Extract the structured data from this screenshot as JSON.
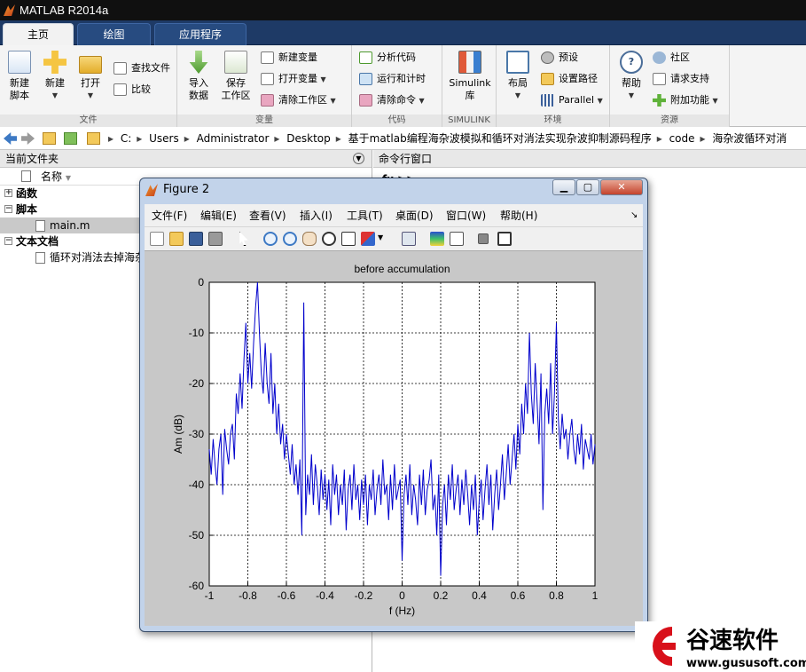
{
  "window": {
    "title": "MATLAB R2014a"
  },
  "tabs": [
    {
      "label": "主页"
    },
    {
      "label": "绘图"
    },
    {
      "label": "应用程序"
    }
  ],
  "ribbon": {
    "file": {
      "name": "文件",
      "new_script_1": "新建",
      "new_script_2": "脚本",
      "new": "新建",
      "open": "打开",
      "find_files": "查找文件",
      "compare": "比较"
    },
    "variable": {
      "name": "变量",
      "import_1": "导入",
      "import_2": "数据",
      "save_1": "保存",
      "save_2": "工作区",
      "new_var": "新建变量",
      "open_var": "打开变量",
      "clear_ws": "清除工作区"
    },
    "code": {
      "name": "代码",
      "analyze": "分析代码",
      "run_time": "运行和计时",
      "clear_cmd": "清除命令"
    },
    "simulink": {
      "name": "SIMULINK",
      "lib_1": "Simulink",
      "lib_2": "库"
    },
    "env": {
      "name": "环境",
      "layout": "布局",
      "prefs": "预设",
      "set_path": "设置路径",
      "parallel": "Parallel"
    },
    "resources": {
      "name": "资源",
      "help": "帮助",
      "community": "社区",
      "support": "请求支持",
      "addons": "附加功能"
    }
  },
  "address": {
    "crumbs": [
      "C:",
      "Users",
      "Administrator",
      "Desktop",
      "基于matlab编程海杂波模拟和循环对消法实现杂波抑制源码程序",
      "code",
      "海杂波循环对消"
    ]
  },
  "current_folder": {
    "title": "当前文件夹",
    "col_name": "名称",
    "items": [
      {
        "label": "函数"
      },
      {
        "label": "脚本"
      },
      {
        "label": "main.m"
      },
      {
        "label": "文本文档"
      },
      {
        "label": "循环对消法去掉海杂"
      }
    ]
  },
  "command_window": {
    "title": "命令行窗口",
    "prompt": "fx >>"
  },
  "figure": {
    "title": "Figure 2",
    "menu": [
      "文件(F)",
      "编辑(E)",
      "查看(V)",
      "插入(I)",
      "工具(T)",
      "桌面(D)",
      "窗口(W)",
      "帮助(H)"
    ]
  },
  "chart_data": {
    "type": "line",
    "title": "before accumulation",
    "xlabel": "f (Hz)",
    "ylabel": "Am (dB)",
    "xlim": [
      -1,
      1
    ],
    "ylim": [
      -60,
      0
    ],
    "xticks": [
      -1,
      -0.8,
      -0.6,
      -0.4,
      -0.2,
      0,
      0.2,
      0.4,
      0.6,
      0.8,
      1
    ],
    "yticks": [
      0,
      -10,
      -20,
      -30,
      -40,
      -50,
      -60
    ],
    "grid": true,
    "series": [
      {
        "color": "#0000cc",
        "x": [
          -1,
          -0.99,
          -0.98,
          -0.97,
          -0.96,
          -0.95,
          -0.94,
          -0.93,
          -0.92,
          -0.91,
          -0.9,
          -0.89,
          -0.88,
          -0.87,
          -0.86,
          -0.85,
          -0.84,
          -0.83,
          -0.82,
          -0.81,
          -0.8,
          -0.79,
          -0.78,
          -0.77,
          -0.76,
          -0.75,
          -0.74,
          -0.73,
          -0.72,
          -0.71,
          -0.7,
          -0.69,
          -0.68,
          -0.67,
          -0.66,
          -0.65,
          -0.64,
          -0.63,
          -0.62,
          -0.61,
          -0.6,
          -0.59,
          -0.58,
          -0.57,
          -0.56,
          -0.55,
          -0.54,
          -0.53,
          -0.52,
          -0.51,
          -0.5,
          -0.49,
          -0.48,
          -0.47,
          -0.46,
          -0.45,
          -0.44,
          -0.43,
          -0.42,
          -0.41,
          -0.4,
          -0.39,
          -0.38,
          -0.37,
          -0.36,
          -0.35,
          -0.34,
          -0.33,
          -0.32,
          -0.31,
          -0.3,
          -0.29,
          -0.28,
          -0.27,
          -0.26,
          -0.25,
          -0.24,
          -0.23,
          -0.22,
          -0.21,
          -0.2,
          -0.19,
          -0.18,
          -0.17,
          -0.16,
          -0.15,
          -0.14,
          -0.13,
          -0.12,
          -0.11,
          -0.1,
          -0.09,
          -0.08,
          -0.07,
          -0.06,
          -0.05,
          -0.04,
          -0.03,
          -0.02,
          -0.01,
          0,
          0.01,
          0.02,
          0.03,
          0.04,
          0.05,
          0.06,
          0.07,
          0.08,
          0.09,
          0.1,
          0.11,
          0.12,
          0.13,
          0.14,
          0.15,
          0.16,
          0.17,
          0.18,
          0.19,
          0.2,
          0.21,
          0.22,
          0.23,
          0.24,
          0.25,
          0.26,
          0.27,
          0.28,
          0.29,
          0.3,
          0.31,
          0.32,
          0.33,
          0.34,
          0.35,
          0.36,
          0.37,
          0.38,
          0.39,
          0.4,
          0.41,
          0.42,
          0.43,
          0.44,
          0.45,
          0.46,
          0.47,
          0.48,
          0.49,
          0.5,
          0.51,
          0.52,
          0.53,
          0.54,
          0.55,
          0.56,
          0.57,
          0.58,
          0.59,
          0.6,
          0.61,
          0.62,
          0.63,
          0.64,
          0.65,
          0.66,
          0.67,
          0.68,
          0.69,
          0.7,
          0.71,
          0.72,
          0.73,
          0.74,
          0.75,
          0.76,
          0.77,
          0.78,
          0.79,
          0.8,
          0.81,
          0.82,
          0.83,
          0.84,
          0.85,
          0.86,
          0.87,
          0.88,
          0.89,
          0.9,
          0.91,
          0.92,
          0.93,
          0.94,
          0.95,
          0.96,
          0.97,
          0.98,
          0.99,
          1
        ],
        "y": [
          -33,
          -38,
          -31,
          -36,
          -40,
          -33,
          -30,
          -42,
          -29,
          -33,
          -36,
          -30,
          -28,
          -35,
          -22,
          -26,
          -18,
          -25,
          -15,
          -8,
          -20,
          -14,
          -21,
          -12,
          -5,
          0,
          -10,
          -18,
          -22,
          -12,
          -20,
          -24,
          -14,
          -26,
          -20,
          -30,
          -24,
          -32,
          -28,
          -35,
          -30,
          -34,
          -38,
          -32,
          -40,
          -36,
          -42,
          -35,
          -50,
          -4,
          -46,
          -38,
          -42,
          -34,
          -44,
          -36,
          -40,
          -46,
          -37,
          -43,
          -38,
          -45,
          -39,
          -48,
          -36,
          -42,
          -38,
          -46,
          -40,
          -44,
          -37,
          -49,
          -41,
          -38,
          -45,
          -36,
          -43,
          -40,
          -47,
          -39,
          -44,
          -38,
          -48,
          -40,
          -43,
          -37,
          -46,
          -41,
          -38,
          -44,
          -35,
          -42,
          -40,
          -47,
          -38,
          -45,
          -36,
          -43,
          -41,
          -39,
          -55,
          -42,
          -38,
          -44,
          -36,
          -46,
          -40,
          -43,
          -48,
          -38,
          -44,
          -37,
          -46,
          -41,
          -39,
          -35,
          -45,
          -42,
          -50,
          -38,
          -58,
          -44,
          -40,
          -48,
          -38,
          -43,
          -36,
          -45,
          -41,
          -38,
          -46,
          -39,
          -44,
          -37,
          -42,
          -48,
          -40,
          -45,
          -38,
          -50,
          -43,
          -39,
          -47,
          -41,
          -36,
          -44,
          -38,
          -49,
          -42,
          -37,
          -45,
          -40,
          -34,
          -43,
          -38,
          -32,
          -40,
          -35,
          -30,
          -37,
          -28,
          -34,
          -24,
          -30,
          -20,
          -26,
          -10,
          -22,
          -28,
          -16,
          -24,
          -32,
          -18,
          -45,
          -26,
          -21,
          -28,
          -16,
          -30,
          -22,
          -8,
          -27,
          -33,
          -26,
          -31,
          -29,
          -35,
          -30,
          -27,
          -33,
          -36,
          -30,
          -34,
          -28,
          -37,
          -31,
          -33,
          -35,
          -30,
          -36,
          -32
        ]
      }
    ]
  }
}
